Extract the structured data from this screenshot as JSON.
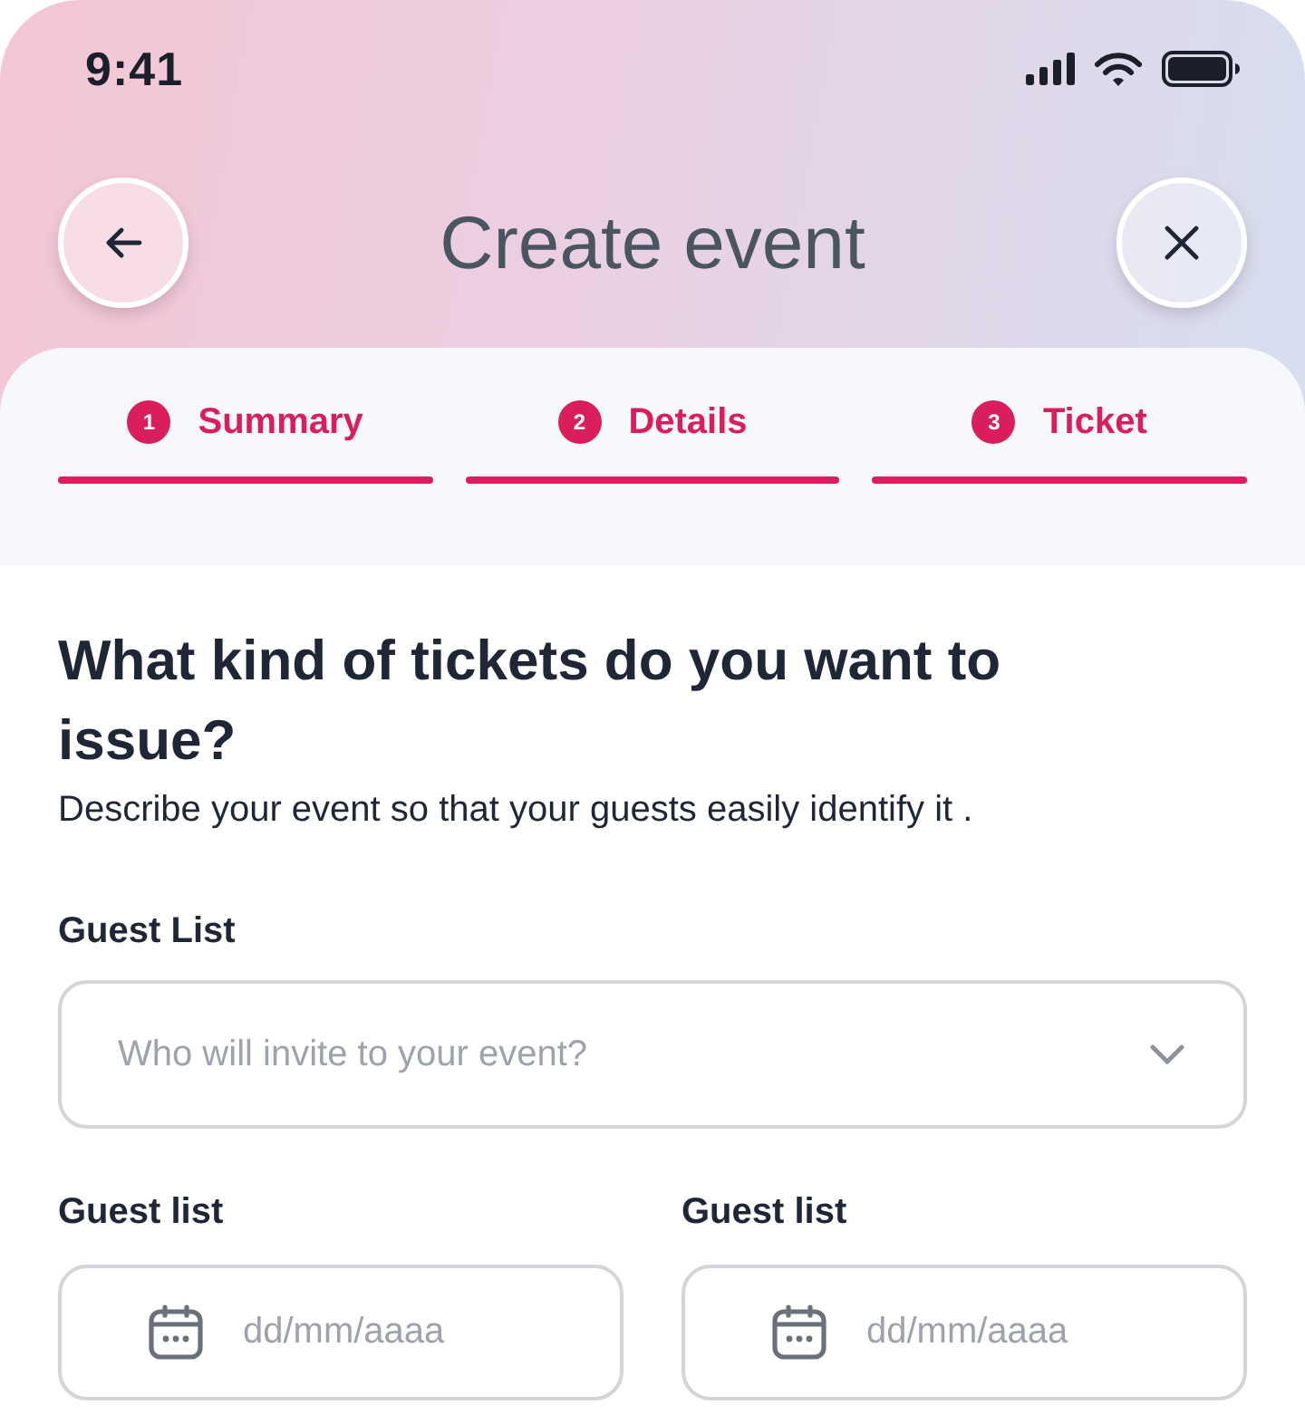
{
  "status_bar": {
    "time": "9:41"
  },
  "header": {
    "title": "Create event"
  },
  "steps": [
    {
      "number": "1",
      "label": "Summary",
      "done": true
    },
    {
      "number": "2",
      "label": "Details",
      "done": true
    },
    {
      "number": "3",
      "label": "Ticket",
      "done": true
    }
  ],
  "question": {
    "title": "What kind of tickets do you want to issue?",
    "description": "Describe your event so that your guests easily identify it ."
  },
  "guest_list": {
    "label": "Guest List",
    "placeholder": "Who will invite to your event?"
  },
  "date_fields": [
    {
      "label": "Guest list",
      "placeholder": "dd/mm/aaaa"
    },
    {
      "label": "Guest list",
      "placeholder": "dd/mm/aaaa"
    }
  ]
}
